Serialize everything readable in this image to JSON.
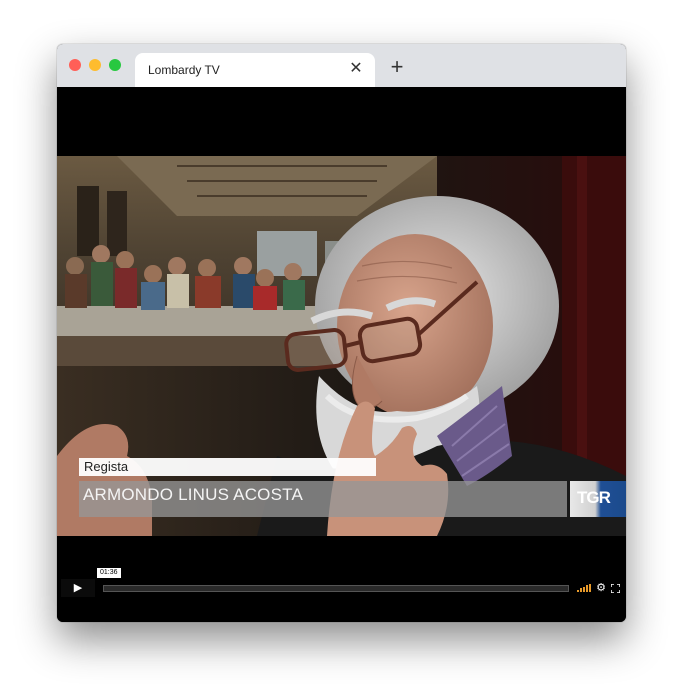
{
  "browser": {
    "tab_title": "Lombardy TV",
    "tab_close_glyph": "✕",
    "new_tab_glyph": "+",
    "traffic_lights": {
      "close": "#ff5f57",
      "minimize": "#febc2e",
      "maximize": "#28c840"
    }
  },
  "video": {
    "caption_role": "Regista",
    "caption_name": "ARMONDO LINUS ACOSTA",
    "channel_logo": "TGR",
    "logo_colors": {
      "light": "#e0e0e0",
      "blue": "#1f4f95"
    }
  },
  "player": {
    "play_glyph": "▶",
    "current_time": "01:36",
    "progress_fraction": 0.0,
    "settings_icon": "gear-icon",
    "fullscreen_icon": "fullscreen-icon",
    "volume_icon": "volume-bars-icon"
  }
}
